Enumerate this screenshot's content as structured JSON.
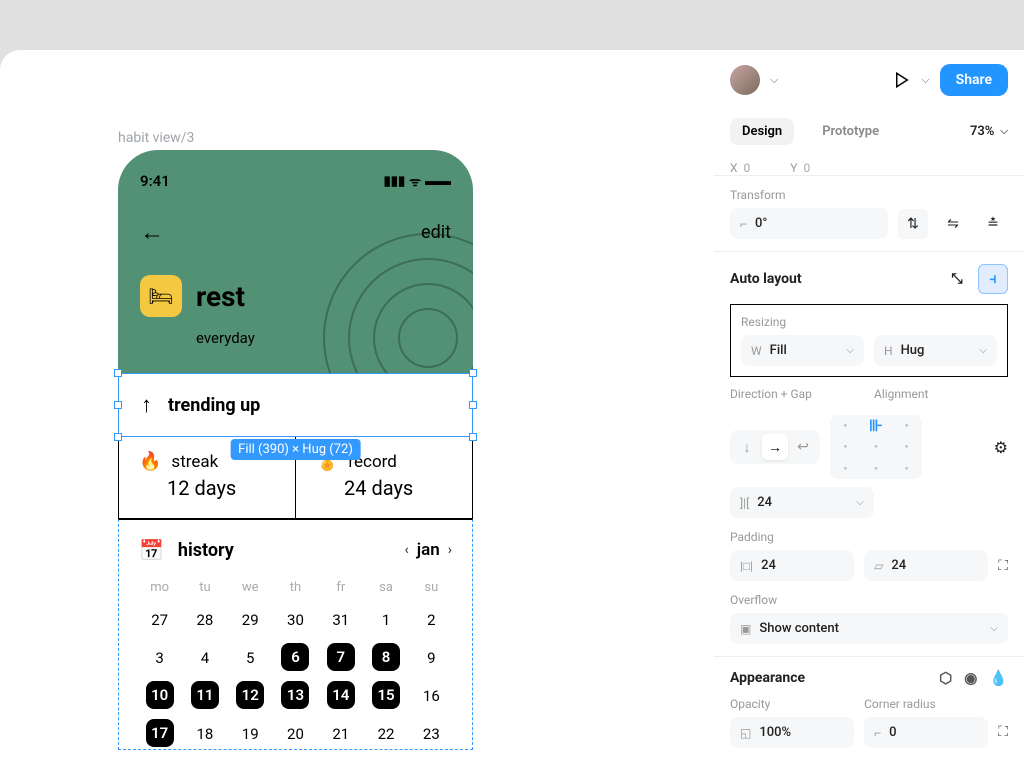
{
  "frame_label": "habit view/3",
  "phone": {
    "time": "9:41",
    "edit": "edit",
    "habit_name": "rest",
    "frequency": "everyday",
    "trending_label": "trending up",
    "dim_badge": "Fill (390) × Hug (72)",
    "streak_label": "streak",
    "streak_value": "12 days",
    "record_label": "record",
    "record_value": "24 days",
    "history_label": "history",
    "month": "jan",
    "weekdays": [
      "mo",
      "tu",
      "we",
      "th",
      "fr",
      "sa",
      "su"
    ],
    "days": [
      {
        "n": "27",
        "m": false
      },
      {
        "n": "28",
        "m": false
      },
      {
        "n": "29",
        "m": false
      },
      {
        "n": "30",
        "m": false
      },
      {
        "n": "31",
        "m": false
      },
      {
        "n": "1",
        "m": false
      },
      {
        "n": "2",
        "m": false
      },
      {
        "n": "3",
        "m": false
      },
      {
        "n": "4",
        "m": false
      },
      {
        "n": "5",
        "m": false
      },
      {
        "n": "6",
        "m": true
      },
      {
        "n": "7",
        "m": true
      },
      {
        "n": "8",
        "m": true
      },
      {
        "n": "9",
        "m": false
      },
      {
        "n": "10",
        "m": true
      },
      {
        "n": "11",
        "m": true
      },
      {
        "n": "12",
        "m": true
      },
      {
        "n": "13",
        "m": true
      },
      {
        "n": "14",
        "m": true
      },
      {
        "n": "15",
        "m": true
      },
      {
        "n": "16",
        "m": false
      },
      {
        "n": "17",
        "m": true
      },
      {
        "n": "18",
        "m": false
      },
      {
        "n": "19",
        "m": false
      },
      {
        "n": "20",
        "m": false
      },
      {
        "n": "21",
        "m": false
      },
      {
        "n": "22",
        "m": false
      },
      {
        "n": "23",
        "m": false
      }
    ]
  },
  "panel": {
    "share": "Share",
    "tab_design": "Design",
    "tab_prototype": "Prototype",
    "zoom": "73%",
    "pos_x_label": "X",
    "pos_x": "0",
    "pos_y_label": "Y",
    "pos_y": "0",
    "transform_label": "Transform",
    "rotation": "0°",
    "autolayout_title": "Auto layout",
    "resizing_label": "Resizing",
    "w_prefix": "W",
    "w_value": "Fill",
    "h_prefix": "H",
    "h_value": "Hug",
    "dir_gap_label": "Direction + Gap",
    "alignment_label": "Alignment",
    "gap_value": "24",
    "padding_label": "Padding",
    "padding_h": "24",
    "padding_v": "24",
    "overflow_label": "Overflow",
    "overflow_value": "Show content",
    "appearance_title": "Appearance",
    "opacity_label": "Opacity",
    "opacity_value": "100%",
    "corner_label": "Corner radius",
    "corner_value": "0"
  }
}
